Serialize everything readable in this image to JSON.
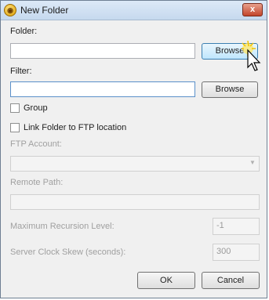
{
  "window": {
    "title": "New Folder",
    "close_label": "x"
  },
  "folder": {
    "label": "Folder:",
    "value": "",
    "browse_label": "Browse"
  },
  "filter": {
    "label": "Filter:",
    "value": "",
    "browse_label": "Browse"
  },
  "group": {
    "label": "Group",
    "checked": false
  },
  "link_ftp": {
    "label": "Link Folder to FTP location",
    "checked": false
  },
  "ftp_account": {
    "label": "FTP Account:",
    "value": ""
  },
  "remote_path": {
    "label": "Remote Path:",
    "value": ""
  },
  "max_recursion": {
    "label": "Maximum Recursion Level:",
    "value": "-1"
  },
  "clock_skew": {
    "label": "Server Clock Skew (seconds):",
    "value": "300"
  },
  "buttons": {
    "ok": "OK",
    "cancel": "Cancel"
  }
}
